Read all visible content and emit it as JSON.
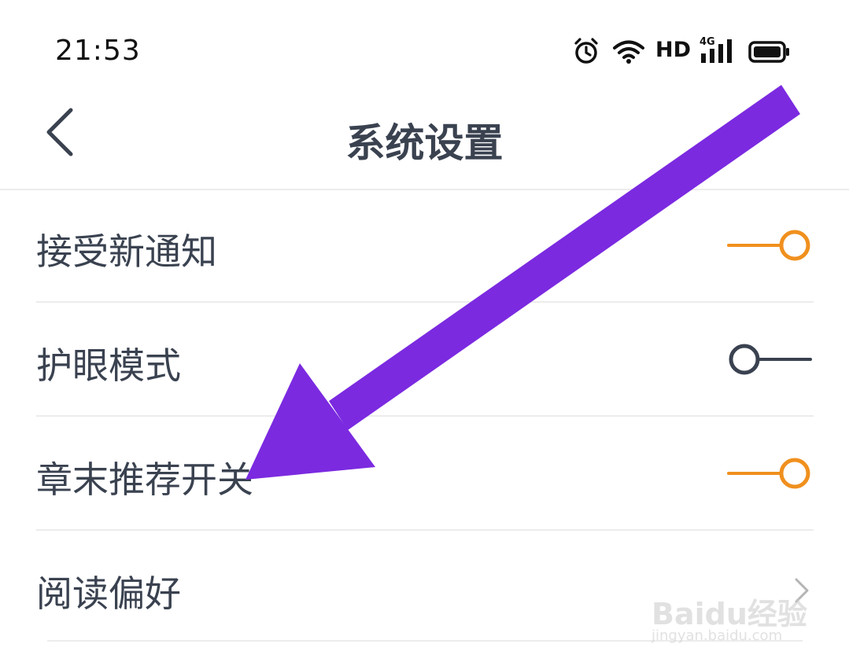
{
  "status_bar": {
    "time": "21:53",
    "hd_label": "HD",
    "network_label": "4G",
    "icons": [
      "alarm-icon",
      "wifi-icon",
      "cellular-signal-icon",
      "battery-icon"
    ]
  },
  "nav": {
    "title": "系统设置",
    "back_icon": "chevron-left-icon"
  },
  "settings": [
    {
      "label": "接受新通知",
      "control": "toggle",
      "on": true
    },
    {
      "label": "护眼模式",
      "control": "toggle",
      "on": false
    },
    {
      "label": "章末推荐开关",
      "control": "toggle",
      "on": true
    },
    {
      "label": "阅读偏好",
      "control": "chevron",
      "icon": "chevron-right-icon"
    }
  ],
  "colors": {
    "toggle_on": "#f0901e",
    "toggle_off": "#3a4250",
    "text": "#3a4250",
    "divider": "#ececec",
    "annotation_arrow": "#7b2ae0"
  },
  "watermark": {
    "text": "Baidu经验",
    "url_text": "jingyan.baidu.com"
  }
}
